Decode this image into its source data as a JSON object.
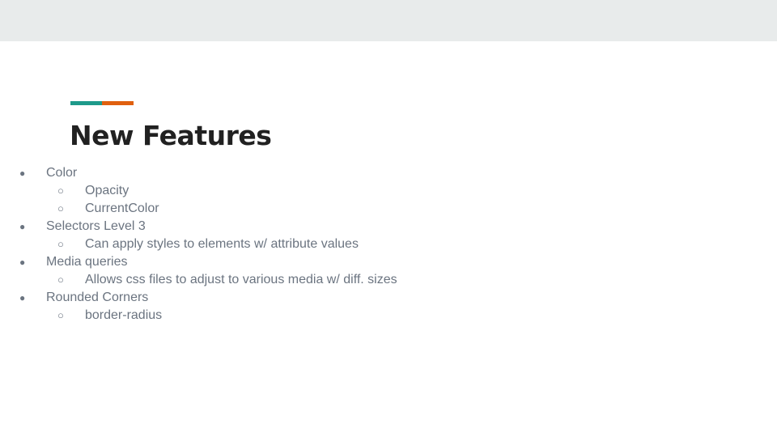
{
  "colors": {
    "background": "#ffffff",
    "top_band": "#e8ebeb",
    "accent_teal": "#1d9a8a",
    "accent_orange": "#e0600f",
    "title": "#212121",
    "body_text": "#6b7480"
  },
  "slide": {
    "title": "New Features",
    "items": [
      {
        "level": 1,
        "marker": "●",
        "text": "Color"
      },
      {
        "level": 2,
        "marker": "○",
        "text": "Opacity"
      },
      {
        "level": 2,
        "marker": "○",
        "text": "CurrentColor"
      },
      {
        "level": 1,
        "marker": "●",
        "text": "Selectors Level 3"
      },
      {
        "level": 2,
        "marker": "○",
        "text": "Can apply styles to elements w/ attribute values"
      },
      {
        "level": 1,
        "marker": "●",
        "text": "Media queries"
      },
      {
        "level": 2,
        "marker": "○",
        "text": "Allows css files to adjust to various media w/ diff. sizes"
      },
      {
        "level": 1,
        "marker": "●",
        "text": "Rounded Corners"
      },
      {
        "level": 2,
        "marker": "○",
        "text": "border-radius"
      }
    ]
  }
}
